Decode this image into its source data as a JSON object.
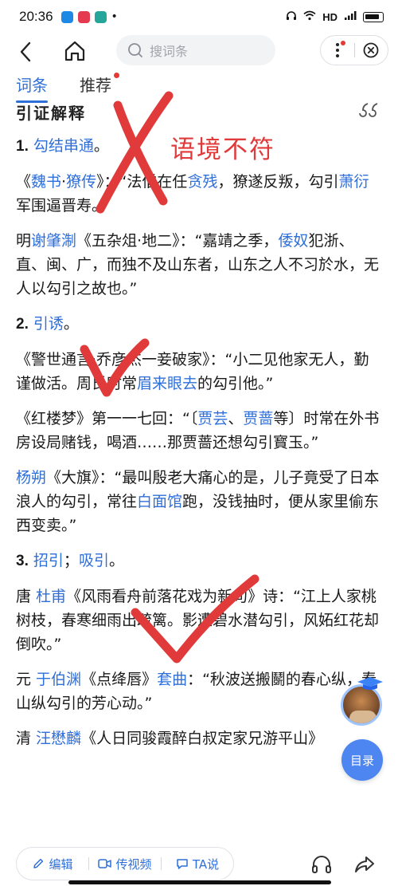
{
  "status_bar": {
    "time": "20:36",
    "network": "HD",
    "signal": "4G",
    "colors": {
      "app1": "#1e88e5",
      "app2": "#e53950",
      "app3": "#26a69a"
    }
  },
  "nav": {
    "search_placeholder": "搜词条"
  },
  "tabs": [
    {
      "label": "词条",
      "active": true
    },
    {
      "label": "推荐",
      "active": false,
      "has_dot": true
    }
  ],
  "section": {
    "title": "引证解释"
  },
  "senses": [
    {
      "num": "1.",
      "head": [
        {
          "t": "勾结串通",
          "link": true
        },
        {
          "t": "。",
          "link": false
        }
      ],
      "quotes": [
        [
          {
            "t": "《",
            "link": false
          },
          {
            "t": "魏书",
            "link": true
          },
          {
            "t": "·",
            "link": false
          },
          {
            "t": "獠传",
            "link": true
          },
          {
            "t": "》：“法僧在任",
            "link": false
          },
          {
            "t": "贪残",
            "link": true
          },
          {
            "t": "，獠遂反叛，勾引",
            "link": false
          },
          {
            "t": "萧衍",
            "link": true
          },
          {
            "t": "军围逼晋寿。”",
            "link": false
          }
        ],
        [
          {
            "t": "明",
            "link": false
          },
          {
            "t": "谢肇淛",
            "link": true
          },
          {
            "t": "《五杂俎·地二》：“嘉靖之季，",
            "link": false
          },
          {
            "t": "倭奴",
            "link": true
          },
          {
            "t": "犯浙、直、闽、广，而独不及山东者，山东之人不习於水，无人以勾引之故也。”",
            "link": false
          }
        ]
      ]
    },
    {
      "num": "2.",
      "head": [
        {
          "t": "引诱",
          "link": true
        },
        {
          "t": "。",
          "link": false
        }
      ],
      "quotes": [
        [
          {
            "t": "《警世通言·乔彦杰一妾破家》：“小二见他家无人，勤谨做活。周氏时常",
            "link": false
          },
          {
            "t": "眉来眼去",
            "link": true
          },
          {
            "t": "的勾引他。”",
            "link": false
          }
        ],
        [
          {
            "t": "《红楼梦》第一一七回：“〔",
            "link": false
          },
          {
            "t": "贾芸",
            "link": true
          },
          {
            "t": "、",
            "link": false
          },
          {
            "t": "贾蔷",
            "link": true
          },
          {
            "t": "等〕时常在外书房设局赌钱，喝酒……那贾蔷还想勾引寳玉。”",
            "link": false
          }
        ],
        [
          {
            "t": "杨朔",
            "link": true
          },
          {
            "t": "《大旗》：“最叫殷老大痛心的是，儿子竟受了日本浪人的勾引，常往",
            "link": false
          },
          {
            "t": "白面馆",
            "link": true
          },
          {
            "t": "跑，没钱抽时，便从家里偷东西变卖。”",
            "link": false
          }
        ]
      ]
    },
    {
      "num": "3.",
      "head": [
        {
          "t": "招引",
          "link": true
        },
        {
          "t": "；",
          "link": false
        },
        {
          "t": "吸引",
          "link": true
        },
        {
          "t": "。",
          "link": false
        }
      ],
      "quotes": [
        [
          {
            "t": "唐 ",
            "link": false
          },
          {
            "t": "杜甫",
            "link": true
          },
          {
            "t": "《风雨看舟前落花戏为新句》诗：“江上人家桃树枝，春寒细雨出疏篱。影遭碧水潜勾引，风妬红花却倒吹。”",
            "link": false
          }
        ],
        [
          {
            "t": "元 ",
            "link": false
          },
          {
            "t": "于伯渊",
            "link": true
          },
          {
            "t": "《点绛唇》",
            "link": false
          },
          {
            "t": "套曲",
            "link": true
          },
          {
            "t": "：“秋波送搬鬭的春心纵，春山纵勾引的芳心动。”",
            "link": false
          }
        ],
        [
          {
            "t": "清 ",
            "link": false
          },
          {
            "t": "汪懋麟",
            "link": true
          },
          {
            "t": "《人日同骏霞醉白叔定家兄游平山》",
            "link": false
          }
        ]
      ]
    }
  ],
  "annotations": {
    "label": "语境不符",
    "color": "#e03a3a"
  },
  "float": {
    "toc_label": "目录"
  },
  "bottom_bar": {
    "edit": "编辑",
    "video": "传视频",
    "ta": "TA说"
  },
  "theme": {
    "accent": "#2f6fd9",
    "alert": "#e53935"
  }
}
